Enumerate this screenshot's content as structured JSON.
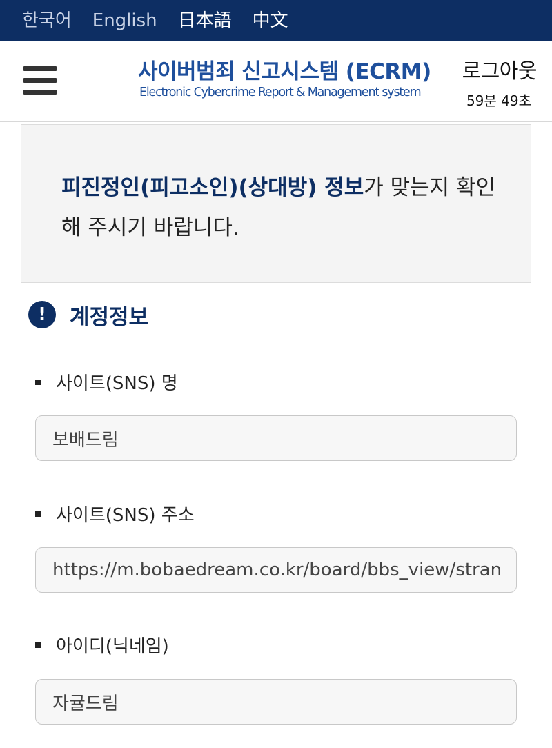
{
  "languages": [
    {
      "label": "한국어"
    },
    {
      "label": "English"
    },
    {
      "label": "日本語"
    },
    {
      "label": "中文"
    }
  ],
  "header": {
    "title": "사이버범죄 신고시스템 (ECRM)",
    "subtitle": "Electronic Cybercrime Report & Management system",
    "logout_label": "로그아웃",
    "session_timer": "59분 49초"
  },
  "notice": {
    "highlight": "피진정인(피고소인)(상대방) 정보",
    "rest": "가 맞는지 확인해 주시기 바랍니다."
  },
  "section": {
    "icon": "exclamation-icon",
    "title": "계정정보"
  },
  "fields": {
    "site_name": {
      "label": "사이트(SNS) 명",
      "value": "보배드림"
    },
    "site_url": {
      "label": "사이트(SNS) 주소",
      "value": "https://m.bobaedream.co.kr/board/bbs_view/strang"
    },
    "user_id": {
      "label": "아이디(닉네임)",
      "value": "자귤드림"
    }
  },
  "colors": {
    "navy": "#0d2e63",
    "brand_blue": "#1e4f9c",
    "panel_bg": "#f4f4f4"
  }
}
